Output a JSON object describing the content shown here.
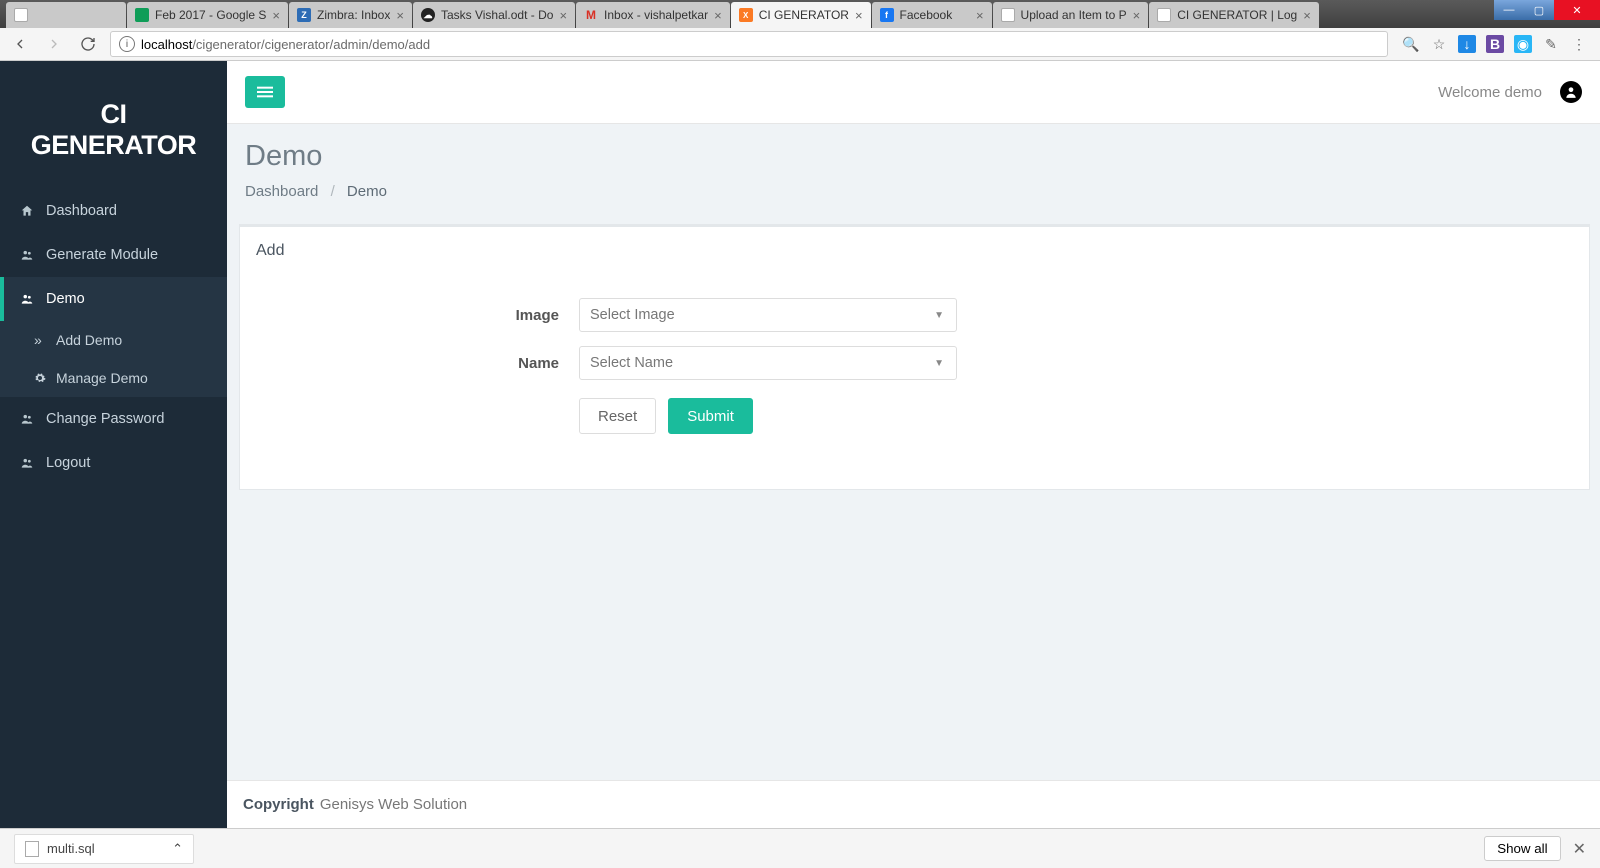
{
  "browser": {
    "tabs": [
      {
        "title": "",
        "favicon": "doc"
      },
      {
        "title": "Feb 2017 - Google S",
        "favicon": "sheet"
      },
      {
        "title": "Zimbra: Inbox",
        "favicon": "zimbra"
      },
      {
        "title": "Tasks Vishal.odt - Do",
        "favicon": "cloud"
      },
      {
        "title": "Inbox - vishalpetkar",
        "favicon": "gmail"
      },
      {
        "title": "CI GENERATOR",
        "favicon": "xampp",
        "active": true
      },
      {
        "title": "Facebook",
        "favicon": "fb"
      },
      {
        "title": "Upload an Item to P",
        "favicon": "upload"
      },
      {
        "title": "CI GENERATOR | Log",
        "favicon": "doc"
      }
    ],
    "url_host": "localhost",
    "url_path": "/cigenerator/cigenerator/admin/demo/add"
  },
  "sidebar": {
    "brand_line1": "CI",
    "brand_line2": "GENERATOR",
    "items": [
      {
        "label": "Dashboard",
        "icon": "home"
      },
      {
        "label": "Generate Module",
        "icon": "users"
      },
      {
        "label": "Demo",
        "icon": "users",
        "active": true,
        "children": [
          {
            "label": "Add Demo",
            "icon": "arrows"
          },
          {
            "label": "Manage Demo",
            "icon": "gear"
          }
        ]
      },
      {
        "label": "Change Password",
        "icon": "users"
      },
      {
        "label": "Logout",
        "icon": "users"
      }
    ]
  },
  "topbar": {
    "welcome": "Welcome demo"
  },
  "page": {
    "title": "Demo",
    "breadcrumb": {
      "root": "Dashboard",
      "sep": "/",
      "current": "Demo"
    }
  },
  "panel": {
    "header": "Add",
    "fields": {
      "image": {
        "label": "Image",
        "placeholder": "Select Image"
      },
      "name": {
        "label": "Name",
        "placeholder": "Select Name"
      }
    },
    "buttons": {
      "reset": "Reset",
      "submit": "Submit"
    }
  },
  "footer": {
    "copyright": "Copyright",
    "company": "Genisys Web Solution"
  },
  "download_shelf": {
    "file": "multi.sql",
    "show_all": "Show all"
  }
}
